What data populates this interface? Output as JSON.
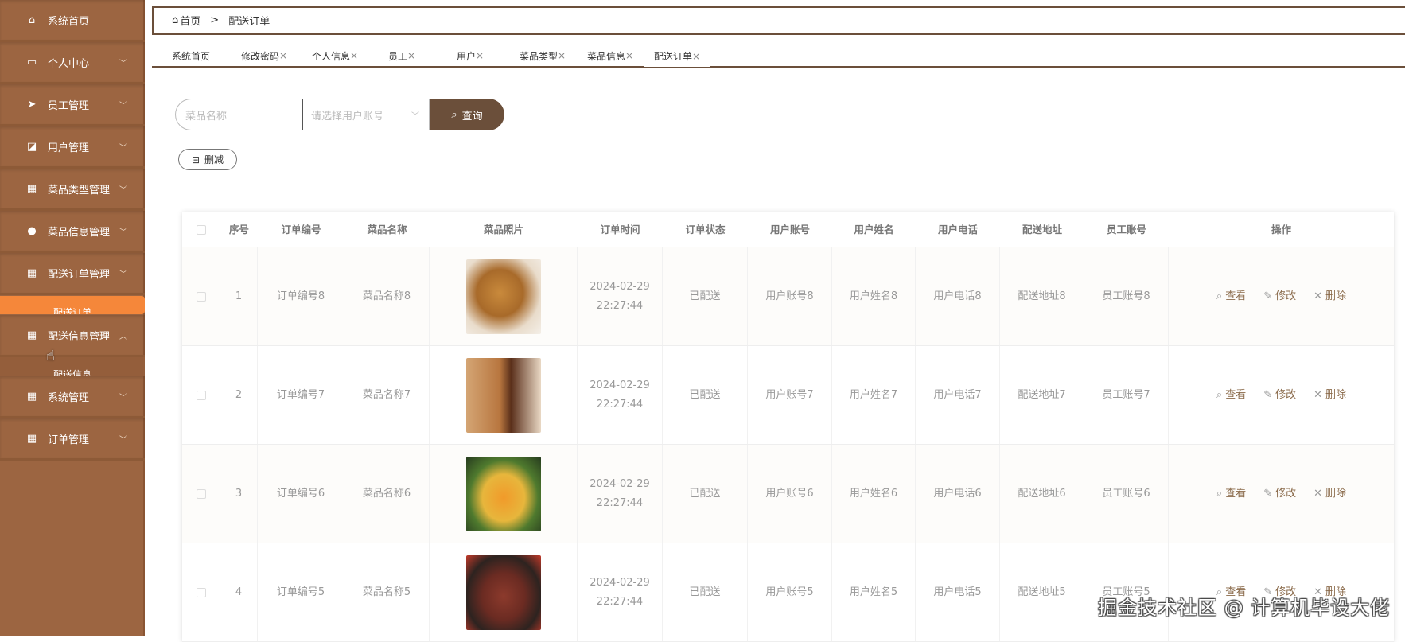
{
  "sidebar": {
    "items": [
      {
        "label": "系统首页",
        "icon": "home-icon"
      },
      {
        "label": "个人中心",
        "icon": "wallet-icon"
      },
      {
        "label": "员工管理",
        "icon": "send-icon"
      },
      {
        "label": "用户管理",
        "icon": "chart-icon"
      },
      {
        "label": "菜品类型管理",
        "icon": "grid-icon"
      },
      {
        "label": "菜品信息管理",
        "icon": "user-icon"
      },
      {
        "label": "配送订单管理",
        "icon": "grid-icon"
      },
      {
        "label": "配送信息管理",
        "icon": "grid-icon"
      },
      {
        "label": "系统管理",
        "icon": "grid-icon"
      },
      {
        "label": "订单管理",
        "icon": "grid-icon"
      }
    ],
    "sub_orders": "配送订单",
    "sub_info": "配送信息",
    "active_color": "#f5873a"
  },
  "breadcrumb": {
    "home": "首页",
    "sep": ">",
    "current": "配送订单"
  },
  "tabs": [
    "系统首页",
    "修改密码",
    "个人信息",
    "员工",
    "用户",
    "菜品类型",
    "菜品信息",
    "配送订单"
  ],
  "tab_close": "×",
  "search": {
    "name_placeholder": "菜品名称",
    "user_placeholder": "请选择用户账号",
    "button": "查询"
  },
  "delete_button": "删减",
  "table": {
    "headers": [
      "序号",
      "订单编号",
      "菜品名称",
      "菜品照片",
      "订单时间",
      "订单状态",
      "用户账号",
      "用户姓名",
      "用户电话",
      "配送地址",
      "员工账号",
      "操作"
    ],
    "actions": {
      "view": "查看",
      "edit": "修改",
      "delete": "删除"
    },
    "rows": [
      {
        "idx": "1",
        "order_no": "订单编号8",
        "dish": "菜品名称8",
        "time": "2024-02-29 22:27:44",
        "status": "已配送",
        "account": "用户账号8",
        "name": "用户姓名8",
        "phone": "用户电话8",
        "address": "配送地址8",
        "staff": "员工账号8"
      },
      {
        "idx": "2",
        "order_no": "订单编号7",
        "dish": "菜品名称7",
        "time": "2024-02-29 22:27:44",
        "status": "已配送",
        "account": "用户账号7",
        "name": "用户姓名7",
        "phone": "用户电话7",
        "address": "配送地址7",
        "staff": "员工账号7"
      },
      {
        "idx": "3",
        "order_no": "订单编号6",
        "dish": "菜品名称6",
        "time": "2024-02-29 22:27:44",
        "status": "已配送",
        "account": "用户账号6",
        "name": "用户姓名6",
        "phone": "用户电话6",
        "address": "配送地址6",
        "staff": "员工账号6"
      },
      {
        "idx": "4",
        "order_no": "订单编号5",
        "dish": "菜品名称5",
        "time": "2024-02-29 22:27:44",
        "status": "已配送",
        "account": "用户账号5",
        "name": "用户姓名5",
        "phone": "用户电话5",
        "address": "配送地址5",
        "staff": "员工账号5"
      }
    ]
  },
  "watermark": "掘金技术社区 @ 计算机毕设大佬"
}
